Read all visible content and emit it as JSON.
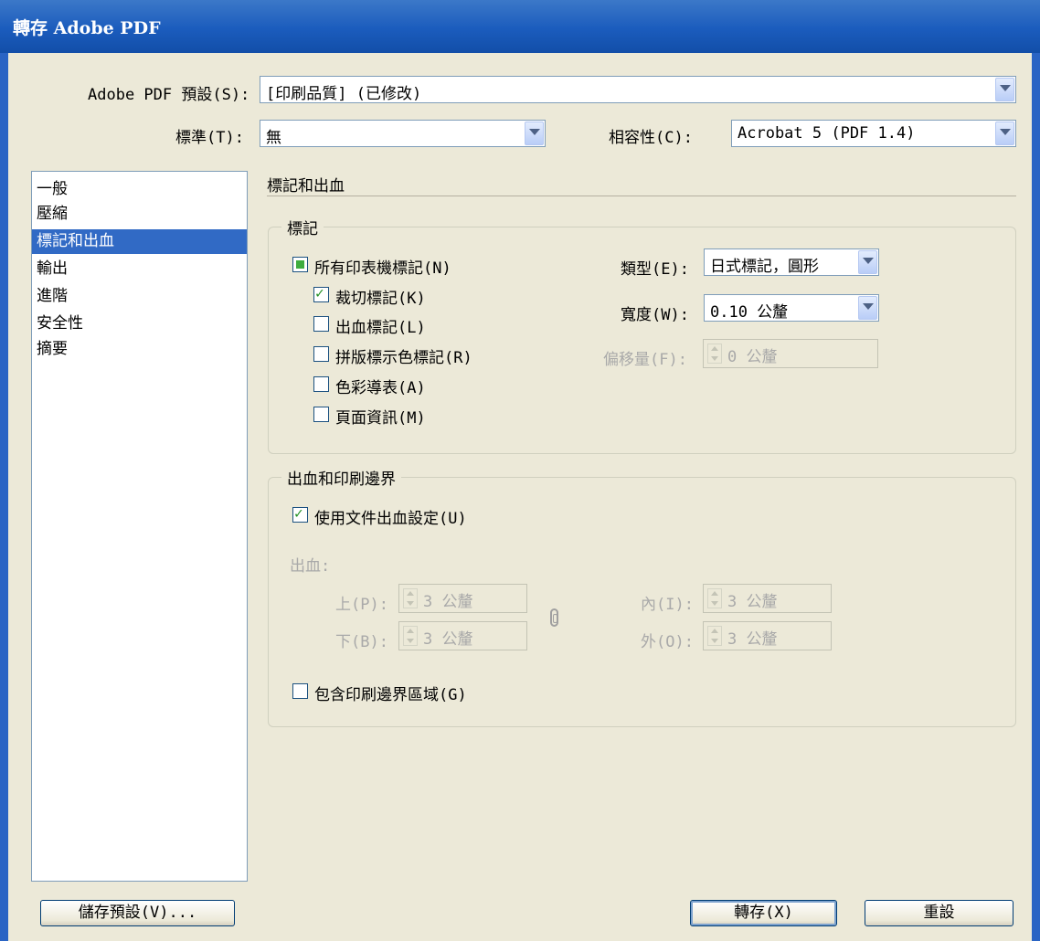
{
  "window": {
    "title": "轉存 Adobe PDF"
  },
  "preset": {
    "label": "Adobe PDF 預設(S):",
    "value": "[印刷品質] (已修改)"
  },
  "standard": {
    "label": "標準(T):",
    "value": "無"
  },
  "compatibility": {
    "label": "相容性(C):",
    "value": "Acrobat 5 (PDF 1.4)"
  },
  "sidebar": {
    "items": [
      {
        "label": "一般"
      },
      {
        "label": "壓縮"
      },
      {
        "label": "標記和出血"
      },
      {
        "label": "輸出"
      },
      {
        "label": "進階"
      },
      {
        "label": "安全性"
      },
      {
        "label": "摘要"
      }
    ],
    "selected_index": 2
  },
  "section_title": "標記和出血",
  "marks": {
    "legend": "標記",
    "all_printer_marks": {
      "label": "所有印表機標記(N)",
      "state": "indeterminate"
    },
    "crop_marks": {
      "label": "裁切標記(K)",
      "checked": true
    },
    "bleed_marks": {
      "label": "出血標記(L)",
      "checked": false
    },
    "registration_marks": {
      "label": "拼版標示色標記(R)",
      "checked": false
    },
    "color_bars": {
      "label": "色彩導表(A)",
      "checked": false
    },
    "page_info": {
      "label": "頁面資訊(M)",
      "checked": false
    },
    "type": {
      "label": "類型(E):",
      "value": "日式標記，圓形"
    },
    "weight": {
      "label": "寬度(W):",
      "value": "0.10 公釐"
    },
    "offset": {
      "label": "偏移量(F):",
      "value": "0 公釐"
    }
  },
  "bleed": {
    "legend": "出血和印刷邊界",
    "use_document_bleed": {
      "label": "使用文件出血設定(U)",
      "checked": true
    },
    "bleed_label": "出血:",
    "top": {
      "label": "上(P):",
      "value": "3 公釐"
    },
    "bottom": {
      "label": "下(B):",
      "value": "3 公釐"
    },
    "inside": {
      "label": "內(I):",
      "value": "3 公釐"
    },
    "outside": {
      "label": "外(O):",
      "value": "3 公釐"
    },
    "include_slug": {
      "label": "包含印刷邊界區域(G)",
      "checked": false
    }
  },
  "buttons": {
    "save_preset": "儲存預設(V)...",
    "export": "轉存(X)",
    "reset": "重設"
  },
  "colors": {
    "title_bar": "#1b5cbd",
    "dialog_bg": "#ece9d8",
    "selection": "#316ac5",
    "check_green": "#3eac3e"
  }
}
